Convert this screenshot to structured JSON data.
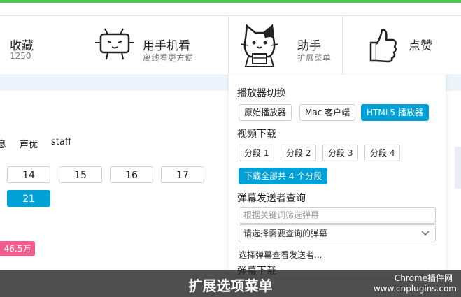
{
  "toolbar": {
    "favorite": {
      "title": "收藏",
      "count": "1250",
      "icon": "star-icon"
    },
    "mobile": {
      "title": "用手机看",
      "sub": "离线看更方便",
      "icon": "tv-phone-mascot-icon"
    },
    "helper": {
      "title": "助手",
      "sub": "扩展菜单",
      "icon": "cat-mascot-icon"
    },
    "like": {
      "title": "点赞",
      "icon": "thumbs-up-icon"
    }
  },
  "tabs": [
    "息",
    "声优",
    "staff"
  ],
  "episodes": [
    "14",
    "15",
    "16",
    "17",
    "21"
  ],
  "badge": "46.5万",
  "panel": {
    "player_switch": {
      "heading": "播放器切换",
      "buttons": [
        "原始播放器",
        "Mac 客户端",
        "HTML5 播放器"
      ]
    },
    "video_download": {
      "heading": "视频下载",
      "segments": [
        "分段 1",
        "分段 2",
        "分段 3",
        "分段 4"
      ],
      "download_all": "下载全部共 4 个分段"
    },
    "danmaku_query": {
      "heading": "弹幕发送者查询",
      "filter_placeholder": "根据关键词筛选弹幕",
      "select_value": "请选择需要查询的弹幕",
      "hint": "选择弹幕查看发送者..."
    },
    "danmaku_download": {
      "heading": "弹幕下载"
    }
  },
  "caption": {
    "text": "扩展选项菜单",
    "watermark_line1": "Chrome插件网",
    "watermark_line2": "www.cnplugins.com"
  },
  "colors": {
    "accent": "#00a1d6",
    "pink": "#f25d8e",
    "green": "#4cc94e"
  }
}
